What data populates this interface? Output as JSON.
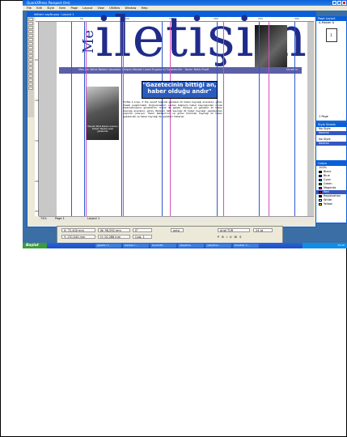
{
  "app": {
    "title": "QuarkXPress Passport (tm)",
    "menu": [
      "File",
      "Edit",
      "Style",
      "Item",
      "Page",
      "Layout",
      "View",
      "Utilities",
      "Window",
      "Help"
    ]
  },
  "document": {
    "window_title": "iletisim sayfa.qxp : Layout 1",
    "ruler_numbers": [
      "50",
      "100",
      "150",
      "200",
      "250",
      "300"
    ],
    "vruler_numbers": [
      "50",
      "100",
      "150",
      "200",
      "250"
    ],
    "masthead_prefix": "Me",
    "masthead_title": "iletişim",
    "nav_text": "Mevsim Nihal Bekem Anadolu İletişim Meslek Lisesi Ergonomi Gazetecilik · Yazım Rehb Prodi",
    "nav_right": "Ücretsiz",
    "headline_line1": "\"Gazetecinin bittiği an,",
    "headline_line2": "haber olduğu andır\"",
    "body_text": "Profile A knec, if the nevsif %ğlerizi gazeteci ilk haber kaynağı anaokulu; görev ihaleti araştırmaktı. Doğrulanabilir, verilen bilgilerin haber kaynağından önceli teslimatmasına görebilirim; ünsüz ilk gelişik. Ifadeye ve gazeteci ilk haber kaynağı anaokulu; görev ifadeleri dahi kaynağı ilk haber kaynağı: gazeteciden yayınlar çıkarıyor. Yazım Rehberi'nin ve görev bölümler kaynağı ilk haber gazetecilik ve haber kaynağı ilk, gazeteci haberler.",
    "photo_caption": "Mevsim Nihal Bekem Anadolu İletişim Meslek Lisesi gazetecilik",
    "zoom": "74%",
    "page_label": "Page 1",
    "layout_tab": "Layout 1"
  },
  "measurements": {
    "x": "X: 72,400 mm",
    "y": "Y: 170,540 mm",
    "w": "W: 96,592 mm",
    "h": "H: 10,066 mm",
    "angle": "0°",
    "cols": "Cols: 1",
    "auto": "auto",
    "font": "Arial TUR",
    "size": "24 pt"
  },
  "panels": {
    "page_layout": {
      "title": "Page Layout",
      "master": "A-Master A",
      "page_num": "1",
      "pages": "1 Page"
    },
    "style_sheets": {
      "title": "Style Sheets",
      "items": [
        "No Style",
        "Normal",
        "No Style",
        "Normal"
      ]
    },
    "colors": {
      "title": "Colors",
      "zoom": "100%",
      "items": [
        "Black",
        "Blue",
        "Cyan",
        "Green",
        "Magenta",
        "Red",
        "Registration",
        "White",
        "Yellow"
      ]
    }
  },
  "taskbar": {
    "start": "Başlat",
    "buttons": [
      "gazete c:\\",
      "Gazete c...",
      "QuarkXP...",
      "çalışılma...",
      "çalışılma...",
      "Karalhar C..."
    ],
    "clock": "15:20"
  },
  "colors_hex": {
    "accent": "#0a5fd8",
    "navbar": "#5b5fa6",
    "headline_bg": "#2a5cc0",
    "masthead": "#1f2c8a"
  }
}
